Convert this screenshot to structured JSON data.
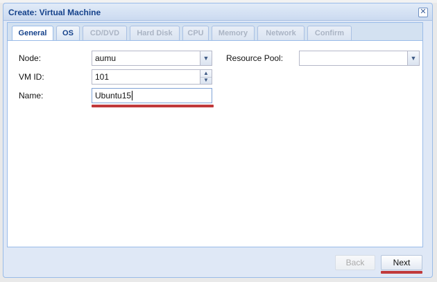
{
  "window": {
    "title": "Create: Virtual Machine",
    "close_glyph": "✕"
  },
  "tabs": [
    {
      "label": "General",
      "state": "active"
    },
    {
      "label": "OS",
      "state": "enabled"
    },
    {
      "label": "CD/DVD",
      "state": "disabled"
    },
    {
      "label": "Hard Disk",
      "state": "disabled"
    },
    {
      "label": "CPU",
      "state": "disabled"
    },
    {
      "label": "Memory",
      "state": "disabled"
    },
    {
      "label": "Network",
      "state": "disabled"
    },
    {
      "label": "Confirm",
      "state": "disabled"
    }
  ],
  "form": {
    "node": {
      "label": "Node:",
      "value": "aumu"
    },
    "vmid": {
      "label": "VM ID:",
      "value": "101"
    },
    "name": {
      "label": "Name:",
      "value": "Ubuntu15"
    },
    "resource_pool": {
      "label": "Resource Pool:",
      "value": ""
    }
  },
  "footer": {
    "back_label": "Back",
    "next_label": "Next"
  },
  "icons": {
    "combo": "▼",
    "spin_up": "▲",
    "spin_down": "▼"
  },
  "colors": {
    "accent": "#15428b",
    "highlight_red": "#c0393b"
  }
}
